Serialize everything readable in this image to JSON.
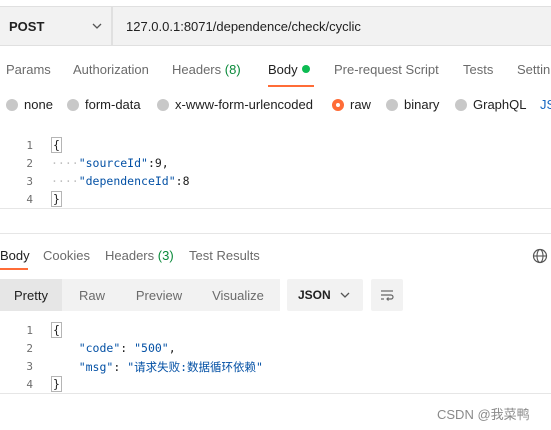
{
  "request": {
    "method": "POST",
    "url": "127.0.0.1:8071/dependence/check/cyclic"
  },
  "request_tabs": {
    "params": "Params",
    "authorization": "Authorization",
    "headers": "Headers",
    "headers_count": "(8)",
    "body": "Body",
    "pre_request": "Pre-request Script",
    "tests": "Tests",
    "settings": "Settin"
  },
  "body_types": {
    "none": "none",
    "form_data": "form-data",
    "urlencoded": "x-www-form-urlencoded",
    "raw": "raw",
    "binary": "binary",
    "graphql": "GraphQL",
    "js": "JS",
    "selected": "raw"
  },
  "request_body": {
    "line_numbers": [
      "1",
      "2",
      "3",
      "4"
    ],
    "line1": "{",
    "line2_key": "\"sourceId\"",
    "line2_rest": ":9,",
    "line3_key": "\"dependenceId\"",
    "line3_rest": ":8",
    "line4": "}"
  },
  "response_tabs": {
    "body": "Body",
    "cookies": "Cookies",
    "headers": "Headers",
    "headers_count": "(3)",
    "test_results": "Test Results"
  },
  "format_toolbar": {
    "pretty": "Pretty",
    "raw": "Raw",
    "preview": "Preview",
    "visualize": "Visualize",
    "format_select": "JSON"
  },
  "response_body": {
    "line_numbers": [
      "1",
      "2",
      "3",
      "4"
    ],
    "line1": "{",
    "line2_key": "\"code\"",
    "line2_value": "\"500\"",
    "line3_key": "\"msg\"",
    "line3_value": "\"请求失败:数据循环依赖\"",
    "line4": "}"
  },
  "watermark": "CSDN @我菜鸭",
  "colors": {
    "accent": "#ff6c37",
    "active_dot": "#0cbb52",
    "count_green": "#0a8a3a",
    "key_blue": "#0451a5"
  }
}
